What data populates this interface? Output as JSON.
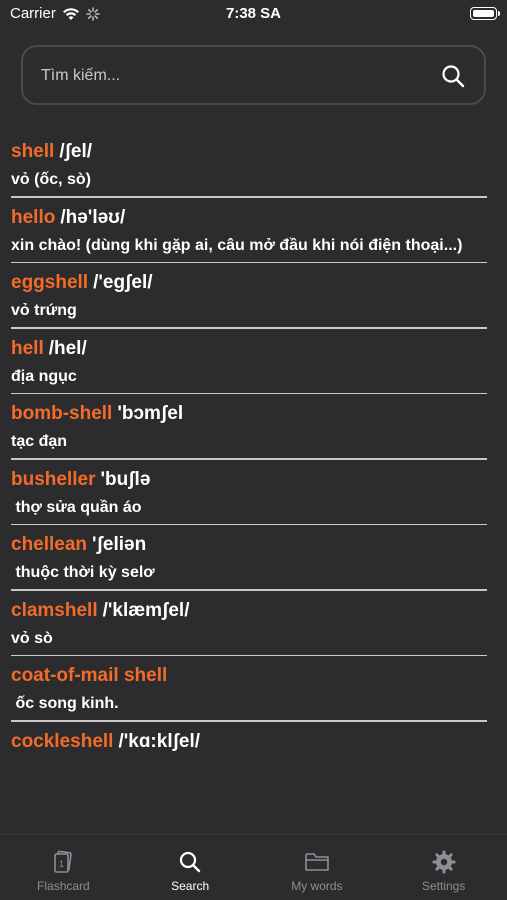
{
  "status": {
    "carrier": "Carrier",
    "time": "7:38 SA"
  },
  "search": {
    "placeholder": "Tìm kiếm..."
  },
  "entries": [
    {
      "word": "shell",
      "phonetic": "/ʃel/",
      "meaning": "vỏ (ốc, sò)"
    },
    {
      "word": "hello",
      "phonetic": "/hə'ləʊ/",
      "meaning": "xin chào! (dùng khi gặp ai, câu mở đầu khi nói điện thoại...)"
    },
    {
      "word": "eggshell",
      "phonetic": "/'egʃel/",
      "meaning": "vỏ trứng"
    },
    {
      "word": "hell",
      "phonetic": "/hel/",
      "meaning": "địa ngục"
    },
    {
      "word": "bomb-shell",
      "phonetic": "'bɔmʃel",
      "meaning": "tạc đạn"
    },
    {
      "word": "busheller",
      "phonetic": "'buʃlə",
      "meaning": " thợ sửa quần áo"
    },
    {
      "word": "chellean",
      "phonetic": "'ʃeliən",
      "meaning": " thuộc thời kỳ selơ"
    },
    {
      "word": "clamshell",
      "phonetic": "/'klæmʃel/",
      "meaning": "vỏ sò"
    },
    {
      "word": "coat-of-mail shell",
      "phonetic": "",
      "meaning": " ốc song kinh."
    },
    {
      "word": "cockleshell",
      "phonetic": "/'kɑ:klʃel/",
      "meaning": ""
    }
  ],
  "tabs": [
    {
      "label": "Flashcard",
      "icon": "flashcard-icon"
    },
    {
      "label": "Search",
      "icon": "search-icon"
    },
    {
      "label": "My words",
      "icon": "folder-icon"
    },
    {
      "label": "Settings",
      "icon": "gear-icon"
    }
  ],
  "colors": {
    "accent": "#f26b2a",
    "background": "#2c2c2e",
    "divider": "#c9c9cb"
  }
}
